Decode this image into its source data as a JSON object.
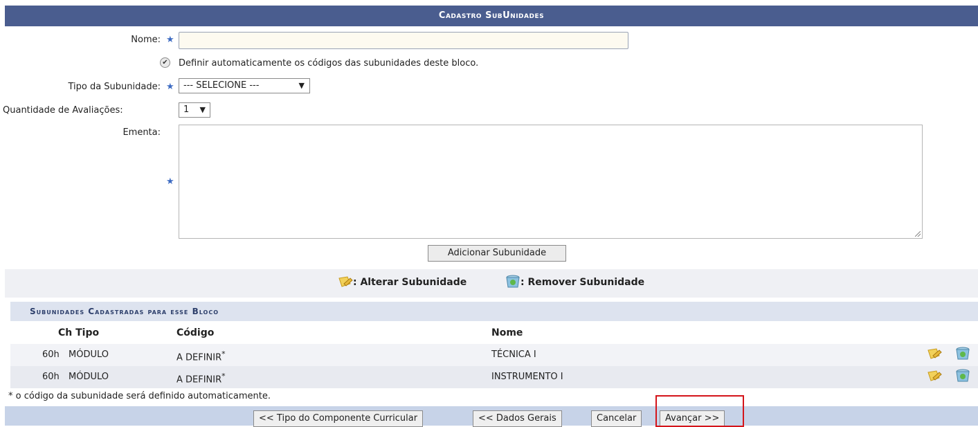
{
  "caption": "Cadastro SubUnidades",
  "form": {
    "nome_label": "Nome:",
    "nome_value": "",
    "auto_codigo_label": "Definir automaticamente os códigos das subunidades deste bloco.",
    "auto_codigo_checked": true,
    "tipo_label": "Tipo da Subunidade:",
    "tipo_selected": "--- SELECIONE ---",
    "qtd_label": "Quantidade de Avaliações:",
    "qtd_selected": "1",
    "ementa_label": "Ementa:",
    "ementa_value": "",
    "required_marker": "★",
    "add_button": "Adicionar Subunidade"
  },
  "legend": {
    "edit_label": ": Alterar Subunidade",
    "remove_label": ": Remover Subunidade",
    "edit_icon": "pencil-note-icon",
    "remove_icon": "recycle-bin-icon"
  },
  "table": {
    "title": "Subunidades Cadastradas para esse Bloco",
    "headers": {
      "ch_tipo": "Ch Tipo",
      "codigo": "Código",
      "nome": "Nome"
    },
    "rows": [
      {
        "ch": "60h",
        "tipo": "MÓDULO",
        "codigo": "A DEFINIR",
        "asterisk": "*",
        "nome": "TÉCNICA I"
      },
      {
        "ch": "60h",
        "tipo": "MÓDULO",
        "codigo": "A DEFINIR",
        "asterisk": "*",
        "nome": "INSTRUMENTO I"
      }
    ],
    "footnote": "* o código da subunidade será definido automaticamente."
  },
  "buttons": {
    "tipo_componente": "<< Tipo do Componente Curricular",
    "dados_gerais": "<< Dados Gerais",
    "cancelar": "Cancelar",
    "avancar": "Avançar >>"
  },
  "colors": {
    "caption_bg": "#4a5d8f",
    "highlight": "#d4141a",
    "required": "#3d6bc2"
  }
}
